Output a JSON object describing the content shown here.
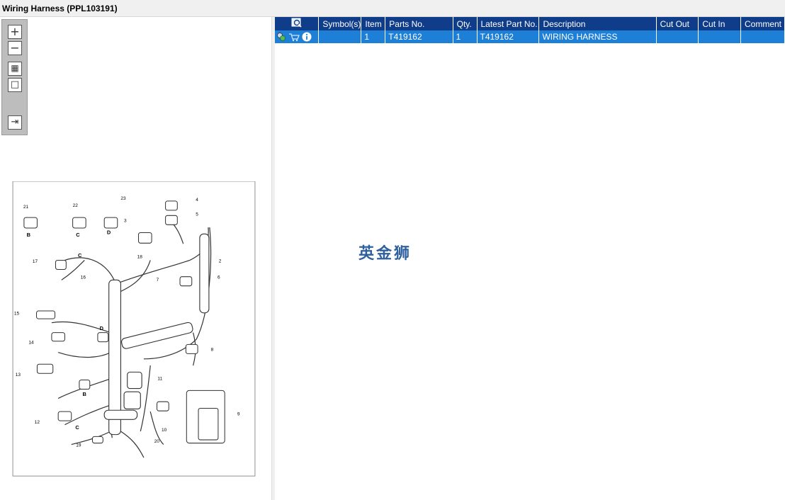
{
  "window": {
    "title": "Wiring Harness (PPL103191)"
  },
  "viewer": {
    "toolbar": [
      {
        "name": "zoom-in-button",
        "icon": "zoom-in-icon",
        "glyph": "+"
      },
      {
        "name": "zoom-out-button",
        "icon": "zoom-out-icon",
        "glyph": "−"
      },
      {
        "name": "fit-all-button",
        "icon": "fit-all-icon",
        "glyph": "▦"
      },
      {
        "name": "fit-window-button",
        "icon": "fit-window-icon",
        "glyph": "□"
      },
      {
        "name": "export-button",
        "icon": "export-icon",
        "glyph": "⇥"
      }
    ],
    "hotspot_marker": "1",
    "callouts": [
      "2",
      "3",
      "4",
      "5",
      "6",
      "7",
      "8",
      "9",
      "10",
      "11",
      "12",
      "13",
      "14",
      "15",
      "16",
      "17",
      "18",
      "19",
      "20",
      "21",
      "22",
      "23"
    ],
    "connector_letters": [
      "B",
      "C",
      "D",
      "D",
      "C",
      "B",
      "C"
    ]
  },
  "parts_table": {
    "columns": {
      "tools": "",
      "symbols": "Symbol(s)",
      "item": "Item",
      "parts_no": "Parts No.",
      "qty": "Qty.",
      "latest_part_no": "Latest Part No.",
      "description": "Description",
      "cut_out": "Cut Out",
      "cut_in": "Cut In",
      "comment": "Comment"
    },
    "rows": [
      {
        "symbols": "",
        "item": "1",
        "parts_no": "T419162",
        "qty": "1",
        "latest_part_no": "T419162",
        "description": "WIRING HARNESS",
        "cut_out": "",
        "cut_in": "",
        "comment": ""
      }
    ]
  },
  "watermark": "英金狮",
  "colors": {
    "header_bg": "#0f3d8a",
    "selected_row_bg": "#1e7fd6",
    "watermark": "#2e5f9e"
  }
}
